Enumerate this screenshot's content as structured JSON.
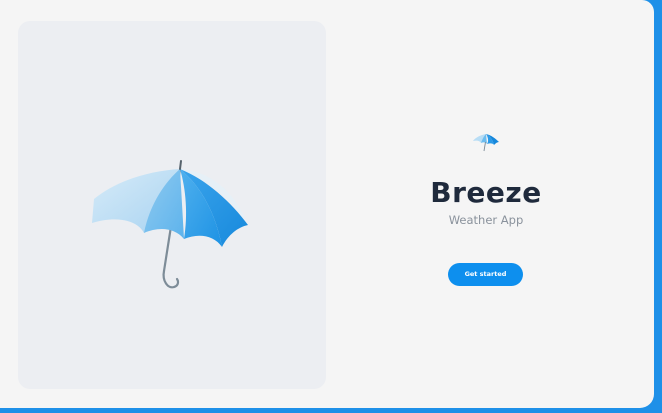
{
  "app": {
    "name": "Breeze",
    "tagline": "Weather App"
  },
  "hero": {
    "illustration_icon": "umbrella-icon"
  },
  "logo": {
    "icon": "umbrella-icon"
  },
  "cta": {
    "label": "Get started"
  },
  "colors": {
    "accent": "#0d8fee",
    "frame": "#1e90e8",
    "background": "#f5f5f5",
    "panel": "#eceef2",
    "title": "#1f2a3c",
    "subtitle": "#8a929c"
  }
}
